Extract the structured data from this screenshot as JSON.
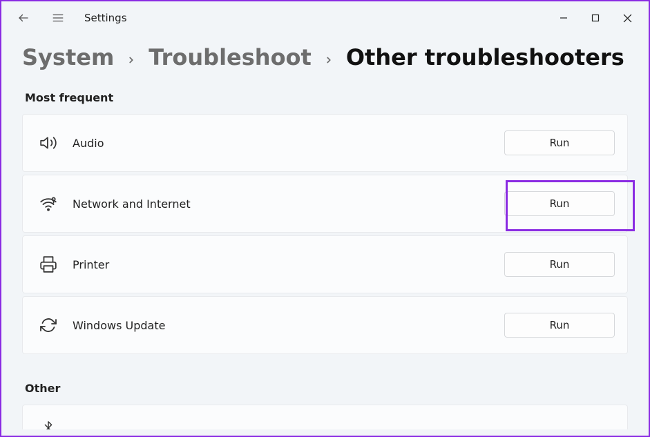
{
  "app_title": "Settings",
  "breadcrumb": {
    "level1": "System",
    "level2": "Troubleshoot",
    "current": "Other troubleshooters"
  },
  "sections": {
    "most_frequent": {
      "title": "Most frequent",
      "items": [
        {
          "label": "Audio",
          "action": "Run",
          "icon": "audio"
        },
        {
          "label": "Network and Internet",
          "action": "Run",
          "icon": "network"
        },
        {
          "label": "Printer",
          "action": "Run",
          "icon": "printer"
        },
        {
          "label": "Windows Update",
          "action": "Run",
          "icon": "update"
        }
      ]
    },
    "other": {
      "title": "Other"
    }
  },
  "highlight_color": "#8a2be2"
}
